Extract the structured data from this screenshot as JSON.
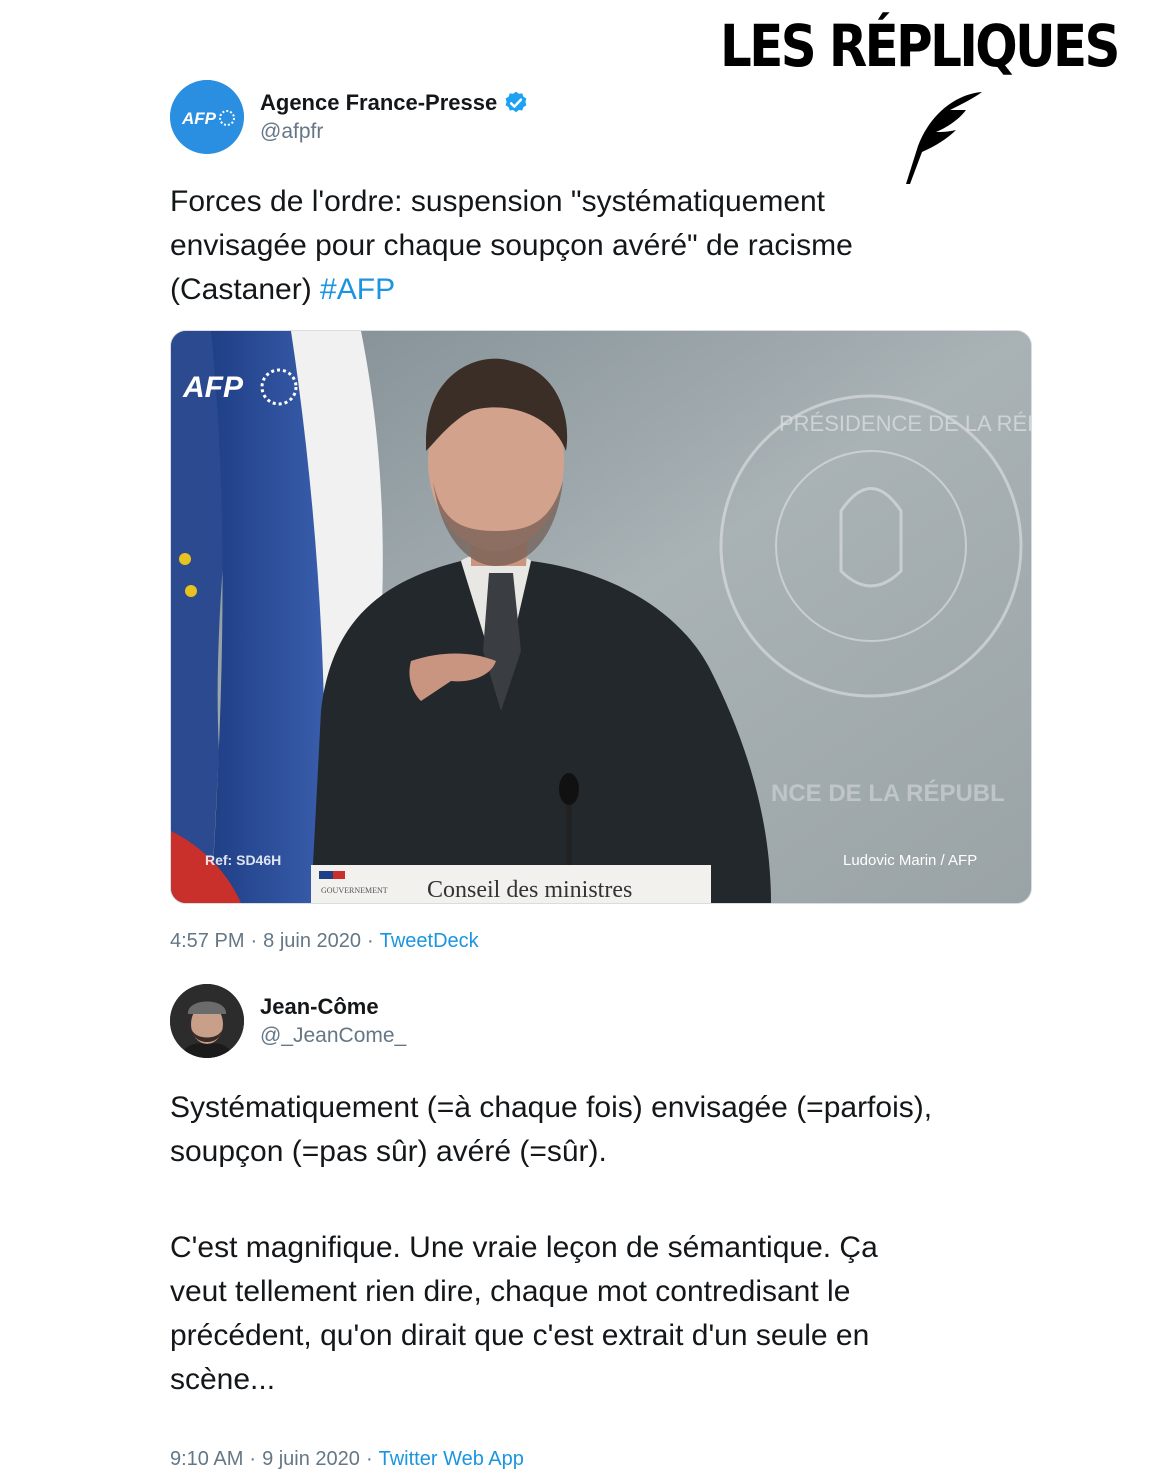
{
  "brand": {
    "title": "LES RÉPLIQUES"
  },
  "tweet1": {
    "author_name": "Agence France-Presse",
    "author_handle": "@afpfr",
    "avatar_text": "AFP",
    "text_main": "Forces de l'ordre: suspension \"systématiquement\nenvisagée pour chaque soupçon avéré\" de racisme\n(Castaner) ",
    "hashtag": "#AFP",
    "media": {
      "watermark": "AFP",
      "ref_caption": "Ref: SD46H",
      "credit": "Ludovic Marin / AFP",
      "podium_sign": "Conseil des ministres",
      "podium_small": "GOUVERNEMENT",
      "seal_text_top": "PRÉSIDENCE DE LA RÉPUBLIQUE",
      "backdrop_text": "NCE DE LA RÉPUBL"
    },
    "time": "4:57 PM",
    "date": "8 juin 2020",
    "source": "TweetDeck"
  },
  "tweet2": {
    "author_name": "Jean-Côme",
    "author_handle": "@_JeanCome_",
    "paragraph1": "Systématiquement (=à chaque fois) envisagée (=parfois),\nsoupçon (=pas sûr) avéré (=sûr).",
    "paragraph2": "C'est magnifique. Une vraie leçon de sémantique. Ça\nveut tellement rien dire, chaque mot contredisant le\nprécédent, qu'on dirait que c'est extrait d'un seule en\nscène...",
    "time": "9:10 AM",
    "date": "9 juin 2020",
    "source": "Twitter Web App"
  },
  "colors": {
    "link": "#1b95e0",
    "secondary": "#657786",
    "verified": "#1da1f2"
  }
}
